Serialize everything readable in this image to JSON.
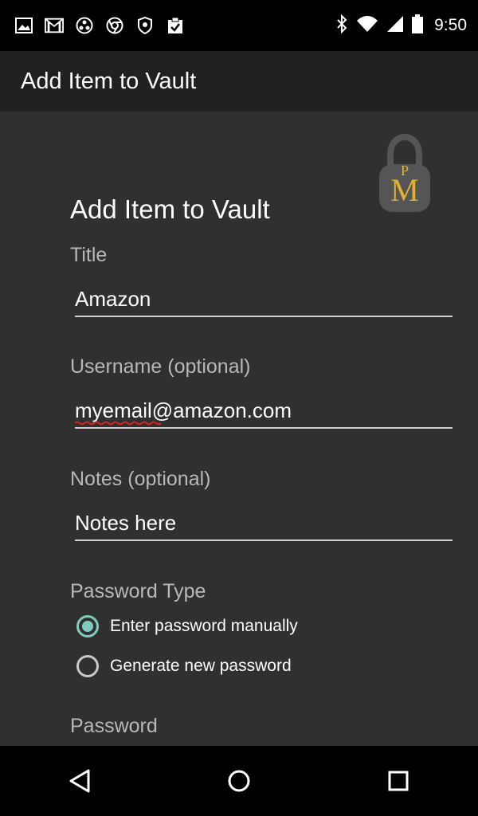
{
  "status_bar": {
    "time": "9:50",
    "left_icons": [
      "image-icon",
      "gmail-icon",
      "cluster-icon",
      "chrome-icon",
      "shield-icon",
      "clipboard-check-icon"
    ],
    "right_icons": [
      "bluetooth-icon",
      "wifi-icon",
      "signal-icon",
      "battery-icon"
    ]
  },
  "app_bar": {
    "title": "Add Item to Vault"
  },
  "logo": {
    "letters": "PM",
    "color": "#e0b030"
  },
  "form": {
    "heading": "Add Item to Vault",
    "title_label": "Title",
    "title_value": "Amazon",
    "username_label": "Username (optional)",
    "username_value": "myemail@amazon.com",
    "notes_label": "Notes (optional)",
    "notes_value": "Notes here",
    "password_type_label": "Password Type",
    "radio_options": [
      {
        "label": "Enter password manually",
        "selected": true
      },
      {
        "label": "Generate new password",
        "selected": false
      }
    ],
    "password_label": "Password"
  },
  "nav_bar": {
    "icons": [
      "back-icon",
      "home-icon",
      "recents-icon"
    ]
  },
  "colors": {
    "accent": "#7fcbc0",
    "background": "#303030",
    "app_bar": "#212121",
    "spellcheck": "#e02020"
  }
}
